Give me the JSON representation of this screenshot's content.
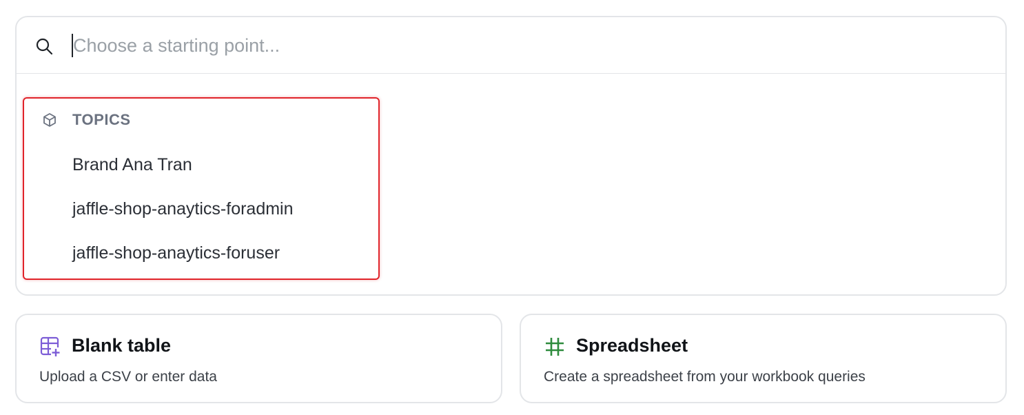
{
  "search": {
    "placeholder": "Choose a starting point..."
  },
  "topics": {
    "heading": "TOPICS",
    "items": [
      {
        "label": "Brand Ana Tran"
      },
      {
        "label": "jaffle-shop-anaytics-foradmin"
      },
      {
        "label": "jaffle-shop-anaytics-foruser"
      }
    ]
  },
  "cards": {
    "blank_table": {
      "title": "Blank table",
      "description": "Upload a CSV or enter data",
      "icon": "table-plus-icon",
      "color": "#7c5cd6"
    },
    "spreadsheet": {
      "title": "Spreadsheet",
      "description": "Create a spreadsheet from your workbook queries",
      "icon": "grid-hash-icon",
      "color": "#2e8b3d"
    }
  },
  "colors": {
    "highlight_border": "#e0232a",
    "panel_border": "#e3e5e8"
  }
}
